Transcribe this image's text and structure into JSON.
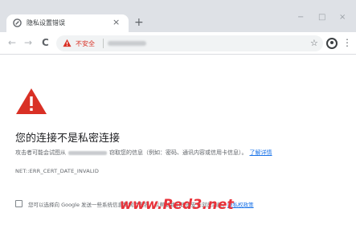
{
  "tab": {
    "title": "隐私设置错误",
    "close_icon": "×",
    "new_tab_icon": "+"
  },
  "window_controls": {
    "minimize": "−",
    "maximize": "□",
    "close": "×"
  },
  "toolbar": {
    "back_icon": "←",
    "forward_icon": "→",
    "reload_icon": "C",
    "not_secure_label": "不安全",
    "star_icon": "☆",
    "menu_icon": "⋮"
  },
  "error_page": {
    "heading": "您的连接不是私密连接",
    "description_before": "攻击者可能会试图从",
    "description_after": "窃取您的信息（例如：密码、通讯内容或信用卡信息）。",
    "learn_more": "了解详情",
    "error_code": "NET::ERR_CERT_DATE_INVALID",
    "optin_text": "您可以选择向 Google 发送一些系统信息和网页内容，以帮助我们改进安全浏览功能。",
    "privacy_link": "隐私权政策"
  },
  "watermark": {
    "text": "www.Red3.net"
  },
  "colors": {
    "warning_red": "#d93025",
    "link_blue": "#1a73e8",
    "titlebar": "#dee1e6",
    "watermark_red": "#e8323a"
  }
}
